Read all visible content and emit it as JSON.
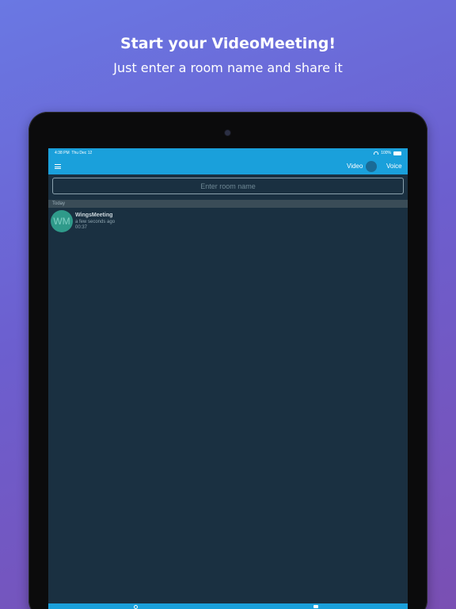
{
  "promo": {
    "headline": "Start your VideoMeeting!",
    "subline": "Just enter a room name and share it"
  },
  "status_bar": {
    "time": "4:38 PM",
    "date": "Thu Dec 12",
    "battery": "100%"
  },
  "navbar": {
    "menu_icon": "hamburger-menu-icon",
    "video_label": "Video",
    "voice_label": "Voice"
  },
  "room_input": {
    "placeholder": "Enter room name",
    "value": ""
  },
  "sections": [
    {
      "header": "Today",
      "items": [
        {
          "initials": "WM",
          "title": "WingsMeeting",
          "subtitle": "a few seconds ago",
          "duration": "00:37"
        }
      ]
    }
  ],
  "colors": {
    "accent": "#1aa0db",
    "screen_bg": "#1a3041",
    "avatar": "#2f9a8a"
  }
}
